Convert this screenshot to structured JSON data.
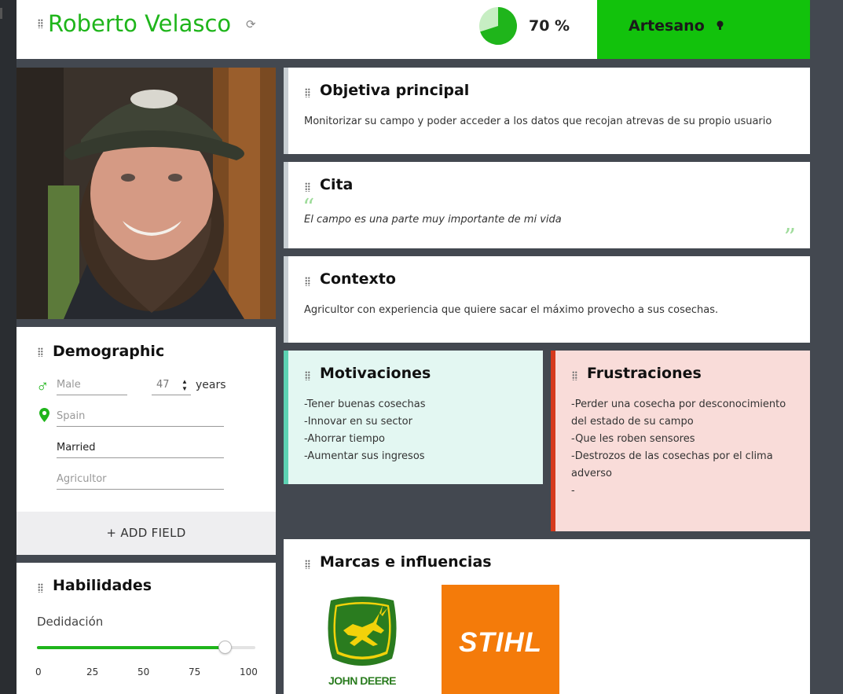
{
  "persona": {
    "name": "Roberto Velasco",
    "completion_pct": 70,
    "completion_label": "70 %",
    "role": "Artesano"
  },
  "colors": {
    "accent": "#1fb51b",
    "role_bg": "#12c20c",
    "page_bg": "#434850",
    "motivation_bg": "#e3f7f2",
    "motivation_bar": "#5dd3b3",
    "frustration_bg": "#f9dcd9",
    "frustration_bar": "#d63a1d"
  },
  "icons": {
    "refresh": "refresh-icon",
    "bulb": "lightbulb-icon",
    "gender": "male-symbol-icon",
    "location": "map-pin-icon",
    "handle": "drag-handle-icon"
  },
  "objetiva": {
    "title": "Objetiva principal",
    "text": "Monitorizar su campo y poder acceder a los datos que recojan atrevas de su propio usuario"
  },
  "cita": {
    "title": "Cita",
    "text": "El campo es una parte muy importante de mi vida"
  },
  "contexto": {
    "title": "Contexto",
    "text": "Agricultor con experiencia que quiere sacar el máximo provecho a sus cosechas."
  },
  "motivaciones": {
    "title": "Motivaciones",
    "lines": [
      "-Tener buenas cosechas",
      "-Innovar en su sector",
      "-Ahorrar tiempo",
      "-Aumentar sus ingresos"
    ]
  },
  "frustraciones": {
    "title": "Frustraciones",
    "lines": [
      "-Perder una cosecha por desconocimiento",
      "del estado de su campo",
      "-Que les roben sensores",
      "-Destrozos de las cosechas por el clima",
      "adverso",
      "-"
    ]
  },
  "demographic": {
    "title": "Demographic",
    "gender_placeholder": "Male",
    "age": "47",
    "age_unit": "years",
    "location_placeholder": "Spain",
    "status_value": "Married",
    "job_placeholder": "Agricultor",
    "add_field_label": "+ ADD FIELD"
  },
  "habilidades": {
    "title": "Habilidades",
    "skills": [
      {
        "name": "Dedidación",
        "value": 86
      }
    ],
    "scale": [
      "0",
      "25",
      "50",
      "75",
      "100"
    ]
  },
  "marcas": {
    "title": "Marcas e influencias",
    "brands": [
      {
        "name": "JOHN DEERE",
        "color": "#2a7c1f",
        "accent": "#f2d20a"
      },
      {
        "name": "STIHL",
        "color": "#f47b0a"
      }
    ]
  }
}
